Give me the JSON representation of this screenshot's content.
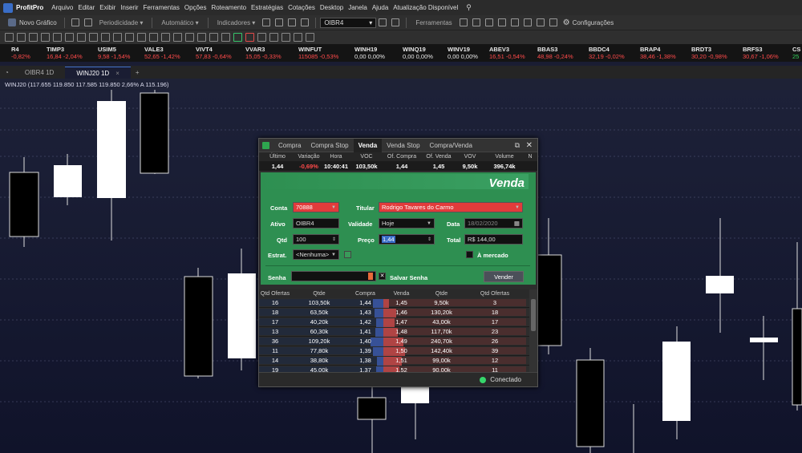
{
  "app": {
    "name": "ProfitPro",
    "menu": [
      "Arquivo",
      "Editar",
      "Exibir",
      "Inserir",
      "Ferramentas",
      "Opções",
      "Roteamento",
      "Estratégias",
      "Cotações",
      "Desktop",
      "Janela",
      "Ajuda",
      "Atualização Disponível"
    ]
  },
  "toolbar": {
    "new_chart": "Novo Gráfico",
    "periodicity": "Periodicidade",
    "automatic": "Automático",
    "indicators": "Indicadores",
    "symbol": "OIBR4",
    "tools": "Ferramentas",
    "settings": "Configurações"
  },
  "ticker": [
    {
      "name": "R4",
      "value": "-0,82%",
      "tone": "neg"
    },
    {
      "name": "TIMP3",
      "value": "16,84 -2,04%",
      "tone": "neg"
    },
    {
      "name": "USIM5",
      "value": "9,58 -1,54%",
      "tone": "neg"
    },
    {
      "name": "VALE3",
      "value": "52,65 -1,42%",
      "tone": "neg"
    },
    {
      "name": "VIVT4",
      "value": "57,83 -0,64%",
      "tone": "neg"
    },
    {
      "name": "VVAR3",
      "value": "15,05 -0,33%",
      "tone": "neg"
    },
    {
      "name": "WINFUT",
      "value": "115085 -0,53%",
      "tone": "neg"
    },
    {
      "name": "WINH19",
      "value": "0,00 0,00%",
      "tone": "zero"
    },
    {
      "name": "WINQ19",
      "value": "0,00 0,00%",
      "tone": "zero"
    },
    {
      "name": "WINV19",
      "value": "0,00 0,00%",
      "tone": "zero"
    },
    {
      "name": "ABEV3",
      "value": "16,51 -0,54%",
      "tone": "neg"
    },
    {
      "name": "BBAS3",
      "value": "48,98 -0,24%",
      "tone": "neg"
    },
    {
      "name": "BBDC4",
      "value": "32,19 -0,02%",
      "tone": "neg"
    },
    {
      "name": "BRAP4",
      "value": "38,46 -1,38%",
      "tone": "neg"
    },
    {
      "name": "BRDT3",
      "value": "30,20 -0,98%",
      "tone": "neg"
    },
    {
      "name": "BRFS3",
      "value": "30,67 -1,06%",
      "tone": "neg"
    },
    {
      "name": "CS",
      "value": "25",
      "tone": "pos"
    }
  ],
  "tabs": [
    {
      "label": "OIBR4 1D"
    },
    {
      "label": "WINJ20 1D"
    }
  ],
  "quote_line": "WINJ20 (117.655  119.850  117.585  119.850  2,66%  A 115.196)",
  "order_window": {
    "tabs": [
      "Compra",
      "Compra Stop",
      "Venda",
      "Venda Stop",
      "Compra/Venda"
    ],
    "active_tab": "Venda",
    "quote_headers": [
      "Último",
      "Variação",
      "Hora",
      "VOC",
      "Of. Compra",
      "Of. Venda",
      "VOV",
      "Volume",
      "N"
    ],
    "quote_values": [
      "1,44",
      "-0,69%",
      "10:40:41",
      "103,50k",
      "1,44",
      "1,45",
      "9,50k",
      "396,74k",
      ""
    ],
    "title": "Venda",
    "labels": {
      "conta": "Conta",
      "titular": "Titular",
      "ativo": "Ativo",
      "validade": "Validade",
      "data": "Data",
      "qtd": "Qtd",
      "preco": "Preço",
      "total": "Total",
      "estrat": "Estrat.",
      "a_mercado": "À mercado",
      "senha": "Senha",
      "salvar_senha": "Salvar Senha",
      "vender": "Vender"
    },
    "fields": {
      "conta": "70888",
      "titular": "Rodrigo Tavares do Carmo",
      "ativo": "OIBR4",
      "validade": "Hoje",
      "data": "18/02/2020",
      "qtd": "100",
      "preco": "1,44",
      "total": "R$ 144,00",
      "estrat": "<Nenhuma>"
    },
    "book_headers": [
      "Qtd Ofertas",
      "Qtde",
      "Compra",
      "Venda",
      "Qtde",
      "Qtd Ofertas"
    ],
    "book_rows": [
      {
        "qo_b": "16",
        "q_b": "103,50k",
        "bid": "1,44",
        "ask": "1,45",
        "q_a": "9,50k",
        "qo_a": "3",
        "bb": 0.3,
        "ab": 0.15
      },
      {
        "qo_b": "18",
        "q_b": "63,50k",
        "bid": "1,43",
        "ask": "1,46",
        "q_a": "130,20k",
        "qo_a": "18",
        "bb": 0.25,
        "ab": 0.35
      },
      {
        "qo_b": "17",
        "q_b": "40,20k",
        "bid": "1,42",
        "ask": "1,47",
        "q_a": "43,00k",
        "qo_a": "17",
        "bb": 0.2,
        "ab": 0.3
      },
      {
        "qo_b": "13",
        "q_b": "60,30k",
        "bid": "1,41",
        "ask": "1,48",
        "q_a": "117,70k",
        "qo_a": "23",
        "bb": 0.22,
        "ab": 0.4
      },
      {
        "qo_b": "36",
        "q_b": "109,20k",
        "bid": "1,40",
        "ask": "1,49",
        "q_a": "240,70k",
        "qo_a": "26",
        "bb": 0.35,
        "ab": 0.55
      },
      {
        "qo_b": "11",
        "q_b": "77,80k",
        "bid": "1,39",
        "ask": "1,50",
        "q_a": "142,40k",
        "qo_a": "39",
        "bb": 0.28,
        "ab": 0.6
      },
      {
        "qo_b": "14",
        "q_b": "38,80k",
        "bid": "1,38",
        "ask": "1,51",
        "q_a": "99,00k",
        "qo_a": "12",
        "bb": 0.18,
        "ab": 0.5
      },
      {
        "qo_b": "19",
        "q_b": "45,00k",
        "bid": "1,37",
        "ask": "1,52",
        "q_a": "90,00k",
        "qo_a": "11",
        "bb": 0.2,
        "ab": 0.45
      }
    ],
    "status": "Conectado"
  },
  "colors": {
    "panel_green": "#2e8f51",
    "conta_red": "#e23b3b",
    "connected_dot": "#36d66b"
  }
}
